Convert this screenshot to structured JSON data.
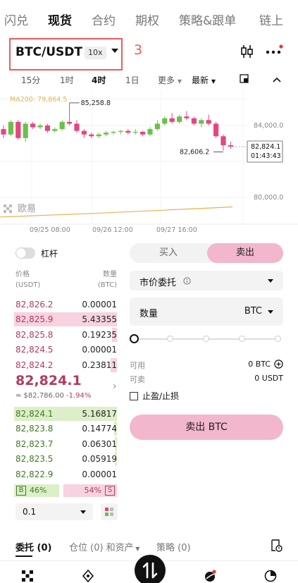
{
  "nav": {
    "tabs": [
      "闪兑",
      "现货",
      "合约",
      "期权",
      "策略&跟单",
      "链上"
    ],
    "active": 1
  },
  "pair": {
    "name": "BTC/USDT",
    "leverage": "10x",
    "annotation": "3"
  },
  "timeframes": {
    "items": [
      "15分",
      "1时",
      "4时",
      "1日"
    ],
    "active": 2,
    "more": "更多",
    "latest": "最新"
  },
  "chart_data": {
    "type": "candlestick",
    "indicator_label": "MA200: 79,864.5",
    "high_label": "85,258.8",
    "low_label": "82,606.2",
    "price_tag": "82,824.1",
    "countdown": "01:43:43",
    "y_ticks": [
      "84,000.0",
      "80,000.0"
    ],
    "y_tick_values": [
      84000,
      80000
    ],
    "x_ticks": [
      "09/25 08:00",
      "09/26 12:00",
      "09/27 16:00"
    ],
    "watermark": "欧易",
    "current": 82824.1,
    "candles": [
      {
        "o": 83800,
        "h": 84000,
        "l": 83300,
        "c": 83500
      },
      {
        "o": 83500,
        "h": 84300,
        "l": 83400,
        "c": 84200
      },
      {
        "o": 84200,
        "h": 84300,
        "l": 83200,
        "c": 83300
      },
      {
        "o": 83300,
        "h": 84200,
        "l": 83100,
        "c": 84100
      },
      {
        "o": 84100,
        "h": 84200,
        "l": 83800,
        "c": 83900
      },
      {
        "o": 83900,
        "h": 84100,
        "l": 83800,
        "c": 84000
      },
      {
        "o": 84000,
        "h": 84100,
        "l": 83600,
        "c": 83700
      },
      {
        "o": 83700,
        "h": 83900,
        "l": 83600,
        "c": 83800
      },
      {
        "o": 83800,
        "h": 84300,
        "l": 83700,
        "c": 84200
      },
      {
        "o": 84200,
        "h": 85259,
        "l": 84000,
        "c": 84100
      },
      {
        "o": 84100,
        "h": 84300,
        "l": 83600,
        "c": 83700
      },
      {
        "o": 83700,
        "h": 83800,
        "l": 83300,
        "c": 83500
      },
      {
        "o": 83500,
        "h": 83600,
        "l": 83300,
        "c": 83400
      },
      {
        "o": 83400,
        "h": 83600,
        "l": 83300,
        "c": 83500
      },
      {
        "o": 83500,
        "h": 83700,
        "l": 83400,
        "c": 83600
      },
      {
        "o": 83600,
        "h": 83700,
        "l": 83500,
        "c": 83650
      },
      {
        "o": 83650,
        "h": 83750,
        "l": 83500,
        "c": 83700
      },
      {
        "o": 83700,
        "h": 83800,
        "l": 83500,
        "c": 83600
      },
      {
        "o": 83600,
        "h": 83800,
        "l": 83500,
        "c": 83650
      },
      {
        "o": 83650,
        "h": 83700,
        "l": 83400,
        "c": 83500
      },
      {
        "o": 83500,
        "h": 83900,
        "l": 83400,
        "c": 83800
      },
      {
        "o": 83800,
        "h": 84300,
        "l": 83700,
        "c": 84100
      },
      {
        "o": 84100,
        "h": 84500,
        "l": 84000,
        "c": 84400
      },
      {
        "o": 84400,
        "h": 84700,
        "l": 84100,
        "c": 84200
      },
      {
        "o": 84200,
        "h": 84600,
        "l": 84100,
        "c": 84500
      },
      {
        "o": 84500,
        "h": 84800,
        "l": 84300,
        "c": 84400
      },
      {
        "o": 84400,
        "h": 84500,
        "l": 84000,
        "c": 84100
      },
      {
        "o": 84100,
        "h": 84400,
        "l": 83900,
        "c": 84300
      },
      {
        "o": 84300,
        "h": 84600,
        "l": 84000,
        "c": 84100
      },
      {
        "o": 84100,
        "h": 84200,
        "l": 83300,
        "c": 83400
      },
      {
        "o": 83400,
        "h": 83500,
        "l": 82606,
        "c": 82900
      },
      {
        "o": 82900,
        "h": 83100,
        "l": 82700,
        "c": 82824
      }
    ],
    "ma200": [
      79300,
      79350,
      79400,
      79450,
      79500,
      79560,
      79620,
      79680,
      79740,
      79800,
      79864
    ]
  },
  "leverage_toggle": {
    "label": "杠杆",
    "on": false
  },
  "orderbook": {
    "price_header": "价格\n(USDT)",
    "qty_header": "数量\n(BTC)",
    "price_h1": "价格",
    "price_h2": "(USDT)",
    "qty_h1": "数量",
    "qty_h2": "(BTC)",
    "asks": [
      {
        "price": "82,826.2",
        "qty": "0.00001",
        "depth": 0
      },
      {
        "price": "82,825.9",
        "qty": "5.43355",
        "depth": 1
      },
      {
        "price": "82,825.8",
        "qty": "0.19235",
        "depth": 0.05
      },
      {
        "price": "82,824.5",
        "qty": "0.00001",
        "depth": 0
      },
      {
        "price": "82,824.2",
        "qty": "0.23811",
        "depth": 0.06
      }
    ],
    "last_price": "82,824.1",
    "ref_price": "≈ $82,786.00",
    "change": "-1.94%",
    "bids": [
      {
        "price": "82,824.1",
        "qty": "5.16817",
        "depth": 1
      },
      {
        "price": "82,823.8",
        "qty": "0.14774",
        "depth": 0.03
      },
      {
        "price": "82,823.7",
        "qty": "0.06301",
        "depth": 0.02
      },
      {
        "price": "82,823.5",
        "qty": "0.05919",
        "depth": 0.02
      },
      {
        "price": "82,822.9",
        "qty": "0.00001",
        "depth": 0
      }
    ],
    "buy_ratio_label": "B",
    "buy_ratio": "46%",
    "sell_ratio": "54%",
    "sell_ratio_label": "S",
    "buy_ratio_value": 0.46,
    "depth_value": "0.1"
  },
  "form": {
    "buy_label": "买入",
    "sell_label": "卖出",
    "order_type": "市价委托",
    "qty_label": "数量",
    "qty_unit": "BTC",
    "available_label": "可用",
    "available_value": "0 BTC",
    "sellable_label": "可卖",
    "sellable_value": "0 USDT",
    "tpsl_label": "止盈/止损",
    "submit_label": "卖出 BTC"
  },
  "bottom_tabs": {
    "orders": "委托 (0)",
    "positions": "仓位 (0) 和资产",
    "strategies": "策略 (0)"
  },
  "colors": {
    "ask": "#b23a5e",
    "bid": "#3f7a22",
    "up_candle": "#6cc04a",
    "down_candle": "#e4467f",
    "ma_line": "#e7b14f",
    "annotation": "#ee5b5b"
  }
}
